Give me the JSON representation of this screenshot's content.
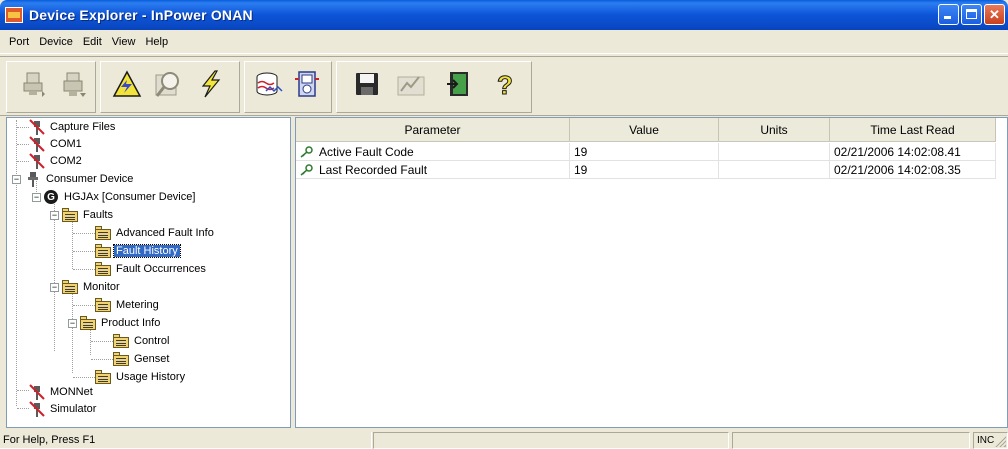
{
  "window": {
    "title": "Device Explorer - InPower ONAN"
  },
  "menu": [
    "Port",
    "Device",
    "Edit",
    "View",
    "Help"
  ],
  "tree": {
    "items": [
      {
        "label": "Capture Files",
        "kind": "port-disconnected"
      },
      {
        "label": "COM1",
        "kind": "port-disconnected"
      },
      {
        "label": "COM2",
        "kind": "port-disconnected"
      },
      {
        "label": "Consumer Device",
        "kind": "port"
      },
      {
        "label": "HGJAx [Consumer Device]",
        "kind": "device"
      },
      {
        "label": "Faults",
        "kind": "folder"
      },
      {
        "label": "Advanced Fault Info",
        "kind": "folder"
      },
      {
        "label": "Fault History",
        "kind": "folder",
        "selected": true
      },
      {
        "label": "Fault Occurrences",
        "kind": "folder"
      },
      {
        "label": "Monitor",
        "kind": "folder"
      },
      {
        "label": "Metering",
        "kind": "folder"
      },
      {
        "label": "Product Info",
        "kind": "folder"
      },
      {
        "label": "Control",
        "kind": "folder"
      },
      {
        "label": "Genset",
        "kind": "folder"
      },
      {
        "label": "Usage History",
        "kind": "folder"
      },
      {
        "label": "MONNet",
        "kind": "port-disconnected"
      },
      {
        "label": "Simulator",
        "kind": "port-disconnected"
      }
    ],
    "device_badge": "G"
  },
  "list": {
    "columns": [
      "Parameter",
      "Value",
      "Units",
      "Time Last Read"
    ],
    "rows": [
      {
        "parameter": "Active Fault Code",
        "value": "19",
        "units": "",
        "time": "02/21/2006 14:02:08.41"
      },
      {
        "parameter": "Last Recorded Fault",
        "value": "19",
        "units": "",
        "time": "02/21/2006 14:02:08.35"
      }
    ]
  },
  "toolbar": {
    "buttons": [
      "connect-icon",
      "disconnect-icon",
      "warning-triangle-icon",
      "search-icon",
      "lightning-icon",
      "capture-icon",
      "meter-icon",
      "save-icon",
      "signal-icon",
      "exit-door-icon",
      "help-icon"
    ],
    "help_glyph": "?"
  },
  "status": {
    "help_text": "For Help, Press F1",
    "indicator": "INC"
  },
  "colors": {
    "titlebar": "#0a54d8",
    "selection": "#316ac5",
    "close_button": "#c8401c"
  }
}
